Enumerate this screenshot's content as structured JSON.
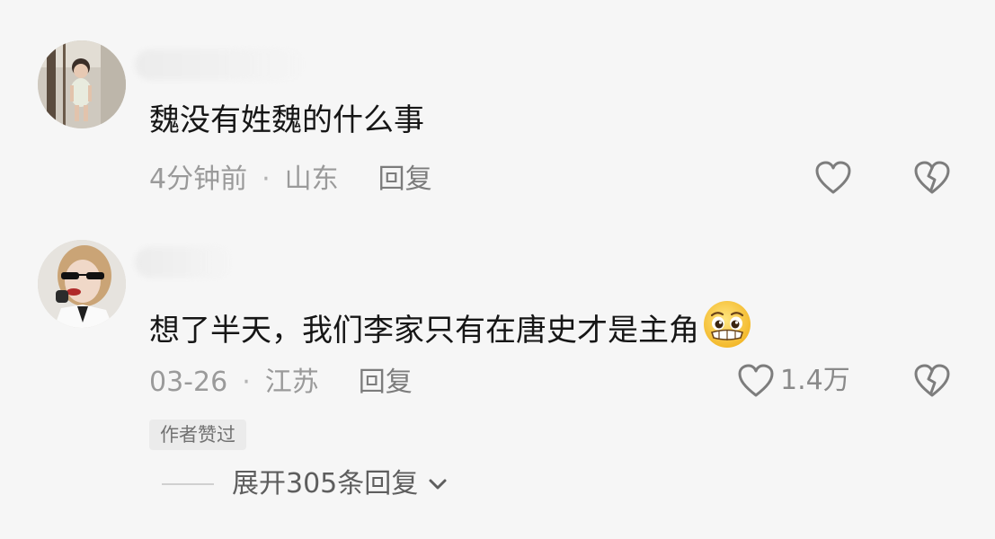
{
  "comments": [
    {
      "text": "魏没有姓魏的什么事",
      "time": "4分钟前",
      "separator": "·",
      "location": "山东",
      "reply_label": "回复",
      "like_count": "",
      "avatar_icon": "baby-photo-avatar"
    },
    {
      "text": "想了半天，我们李家只有在唐史才是主角",
      "emoji_icon": "pleading-face-emoji",
      "time": "03-26",
      "separator": "·",
      "location": "江苏",
      "reply_label": "回复",
      "like_count": "1.4万",
      "badge": "作者赞过",
      "avatar_icon": "woman-sunglasses-avatar"
    }
  ],
  "expand_replies": {
    "label": "展开305条回复"
  },
  "colors": {
    "background": "#f6f6f6",
    "text_primary": "#161616",
    "text_meta": "#9a9a9a",
    "icon": "#7d7d7d"
  }
}
